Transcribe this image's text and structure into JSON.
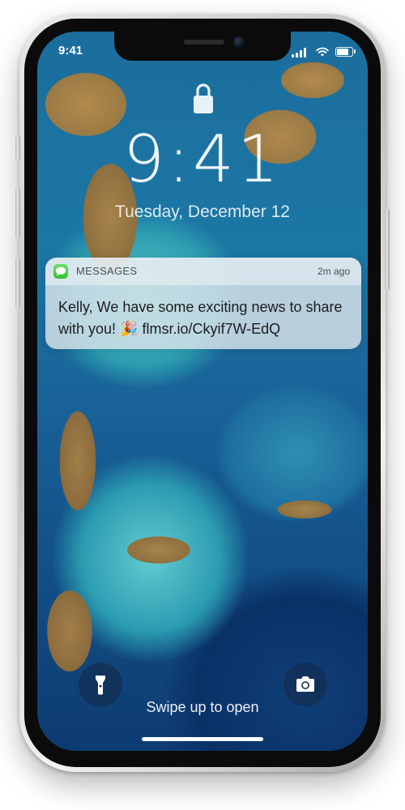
{
  "status_bar": {
    "time": "9:41",
    "battery_level": 0.9
  },
  "lock_screen": {
    "clock": "9:41",
    "date": "Tuesday, December 12",
    "swipe_hint": "Swipe up to open"
  },
  "notification": {
    "app": "MESSAGES",
    "time": "2m ago",
    "body": "Kelly, We have some exciting news to share with you! 🎉 flmsr.io/Ckyif7W-EdQ",
    "icon": "messages-icon"
  },
  "controls": {
    "left_icon": "flashlight-icon",
    "right_icon": "camera-icon"
  },
  "colors": {
    "messages_green": "#34c759",
    "notification_bg": "#d7e1e8"
  }
}
